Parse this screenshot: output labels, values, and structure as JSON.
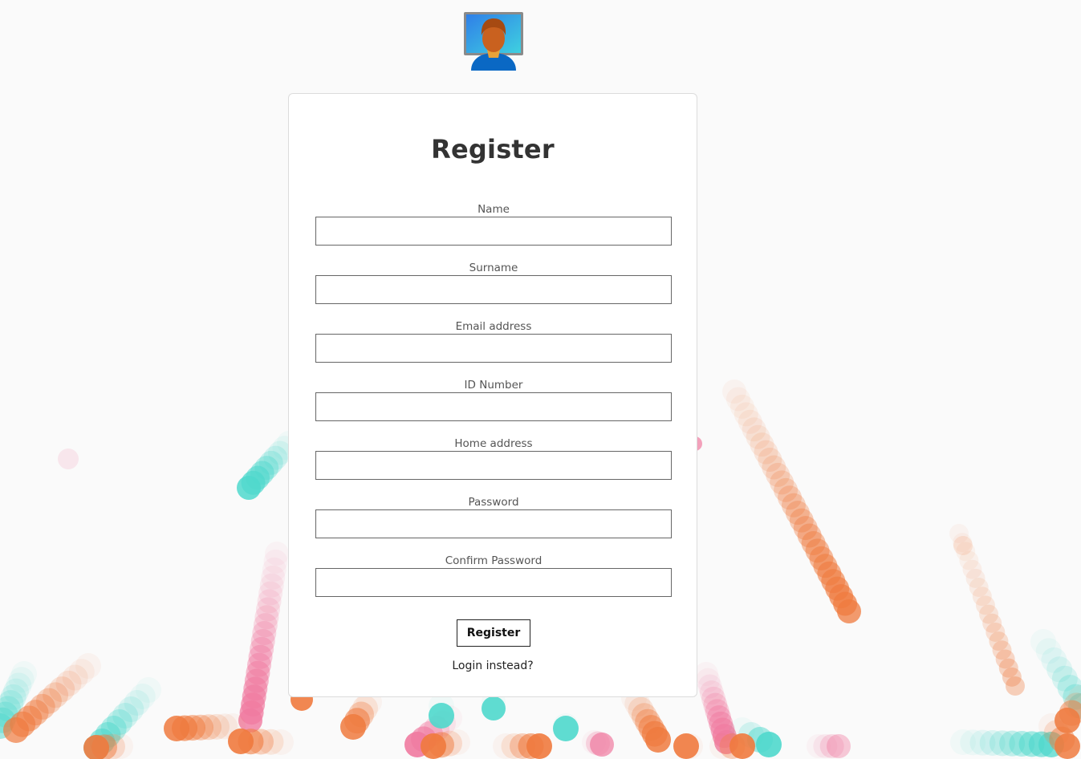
{
  "page": {
    "title": "Register",
    "colors": {
      "background": "#fafafa",
      "card": "#ffffff",
      "teal": "#4fd8cc",
      "orange": "#ef7a3e",
      "pink": "#f07aa0"
    }
  },
  "logo": {
    "icon": "user-monitor-icon"
  },
  "form": {
    "fields": [
      {
        "label": "Name",
        "value": "",
        "type": "text"
      },
      {
        "label": "Surname",
        "value": "",
        "type": "text"
      },
      {
        "label": "Email address",
        "value": "",
        "type": "email"
      },
      {
        "label": "ID Number",
        "value": "",
        "type": "text"
      },
      {
        "label": "Home address",
        "value": "",
        "type": "text"
      },
      {
        "label": "Password",
        "value": "",
        "type": "password"
      },
      {
        "label": "Confirm Password",
        "value": "",
        "type": "password"
      }
    ],
    "submit_label": "Register",
    "login_link": "Login instead?"
  }
}
